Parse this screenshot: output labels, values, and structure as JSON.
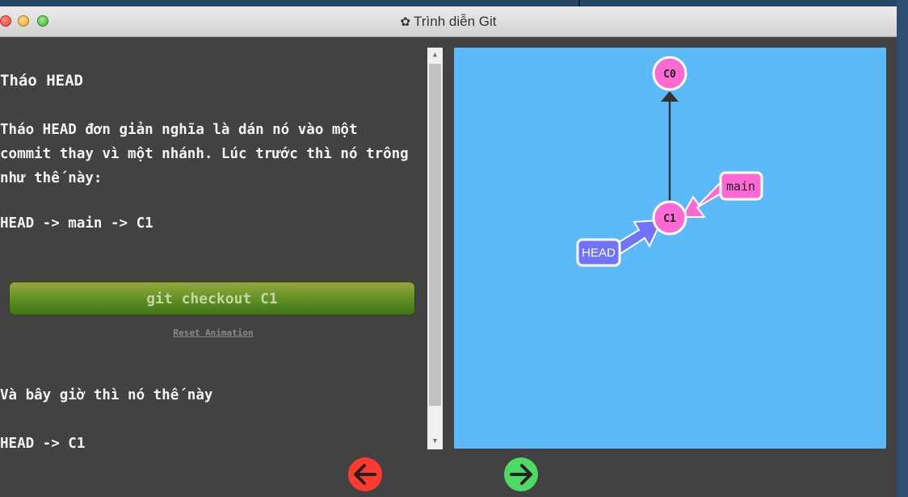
{
  "window": {
    "title": "Trình diễn Git",
    "icon": "gear-icon"
  },
  "lesson": {
    "heading": "Tháo HEAD",
    "paragraph_lines": [
      "Tháo HEAD đơn giản nghĩa là dán nó vào một",
      "commit thay vì một nhánh. Lúc trước thì nó trông",
      "như thế này:"
    ],
    "code_before": "HEAD -> main -> C1",
    "command_label": "git checkout C1",
    "reset_label": "Reset Animation",
    "after_text": "Và bây giờ thì nó thế này",
    "code_after": "HEAD -> C1"
  },
  "graph": {
    "commits": [
      "C0",
      "C1"
    ],
    "branch_label": "main",
    "head_label": "HEAD",
    "background": "#5cbaf9",
    "commit_color": "#ff69d4",
    "head_color": "#6f73ff",
    "branch_color": "#ff69d4"
  },
  "nav": {
    "prev_icon": "arrow-left-icon",
    "next_icon": "arrow-right-icon",
    "prev_color": "#ff3b30",
    "next_color": "#4cd964"
  }
}
